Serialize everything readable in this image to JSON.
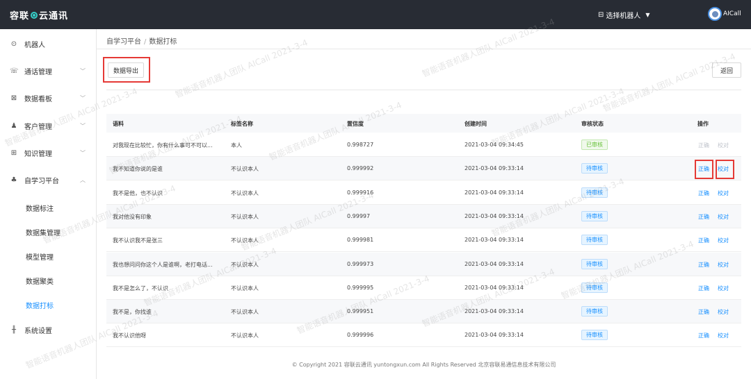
{
  "header": {
    "logo_left": "容联",
    "logo_right": "云通讯",
    "robot_select_label": "选择机器人",
    "user_name": "AICall"
  },
  "sidebar": {
    "items": [
      {
        "label": "机器人",
        "icon": "robot-icon"
      },
      {
        "label": "通话管理",
        "icon": "phone-icon"
      },
      {
        "label": "数据看板",
        "icon": "chart-icon"
      },
      {
        "label": "客户管理",
        "icon": "users-icon"
      },
      {
        "label": "知识管理",
        "icon": "book-icon"
      },
      {
        "label": "自学习平台",
        "icon": "learn-icon"
      },
      {
        "label": "系统设置",
        "icon": "settings-icon"
      }
    ],
    "sub_items": [
      {
        "label": "数据标注"
      },
      {
        "label": "数据集管理"
      },
      {
        "label": "模型管理"
      },
      {
        "label": "数据聚类"
      },
      {
        "label": "数据打标",
        "active": true
      }
    ]
  },
  "breadcrumb": {
    "parent": "自学习平台",
    "separator": "/",
    "current": "数据打标"
  },
  "toolbar": {
    "export_label": "数据导出",
    "back_label": "返回"
  },
  "table": {
    "headers": [
      "语料",
      "标签名称",
      "置信度",
      "创建时间",
      "审核状态",
      "操作"
    ],
    "rows": [
      {
        "corpus": "对我现在比较忙，你有什么事可不可以...",
        "tag": "本人",
        "confidence": "0.998727",
        "created": "2021-03-04 09:34:45",
        "status": "已审核",
        "status_type": "done",
        "act1": "正确",
        "act2": "校对"
      },
      {
        "corpus": "我不知道你说的是谁",
        "tag": "不认识本人",
        "confidence": "0.999992",
        "created": "2021-03-04 09:33:14",
        "status": "待审核",
        "status_type": "pending",
        "act1": "正确",
        "act2": "校对"
      },
      {
        "corpus": "我不是他，也不认识",
        "tag": "不认识本人",
        "confidence": "0.999916",
        "created": "2021-03-04 09:33:14",
        "status": "待审核",
        "status_type": "pending",
        "act1": "正确",
        "act2": "校对"
      },
      {
        "corpus": "我对他没有印象",
        "tag": "不认识本人",
        "confidence": "0.99997",
        "created": "2021-03-04 09:33:14",
        "status": "待审核",
        "status_type": "pending",
        "act1": "正确",
        "act2": "校对"
      },
      {
        "corpus": "我不认识我不是张三",
        "tag": "不认识本人",
        "confidence": "0.999981",
        "created": "2021-03-04 09:33:14",
        "status": "待审核",
        "status_type": "pending",
        "act1": "正确",
        "act2": "校对"
      },
      {
        "corpus": "我也想问问你这个人是谁啊，老打电话...",
        "tag": "不认识本人",
        "confidence": "0.999973",
        "created": "2021-03-04 09:33:14",
        "status": "待审核",
        "status_type": "pending",
        "act1": "正确",
        "act2": "校对"
      },
      {
        "corpus": "我不是怎么了，不认识",
        "tag": "不认识本人",
        "confidence": "0.999995",
        "created": "2021-03-04 09:33:14",
        "status": "待审核",
        "status_type": "pending",
        "act1": "正确",
        "act2": "校对"
      },
      {
        "corpus": "我不是，你找谁",
        "tag": "不认识本人",
        "confidence": "0.999951",
        "created": "2021-03-04 09:33:14",
        "status": "待审核",
        "status_type": "pending",
        "act1": "正确",
        "act2": "校对"
      },
      {
        "corpus": "我不认识他呀",
        "tag": "不认识本人",
        "confidence": "0.999996",
        "created": "2021-03-04 09:33:14",
        "status": "待审核",
        "status_type": "pending",
        "act1": "正确",
        "act2": "校对"
      }
    ]
  },
  "footer": {
    "text": "© Copyright 2021    容联云通讯    yuntongxun.com    All Rights Reserved  北京容联易通信息技术有限公司"
  },
  "watermark": {
    "text": "智能语音机器人团队  AICall  2021-3-4"
  },
  "colors": {
    "topbar": "#282c34",
    "accent": "#1890ff",
    "highlight": "#e53935",
    "approved": "#67c23a"
  }
}
